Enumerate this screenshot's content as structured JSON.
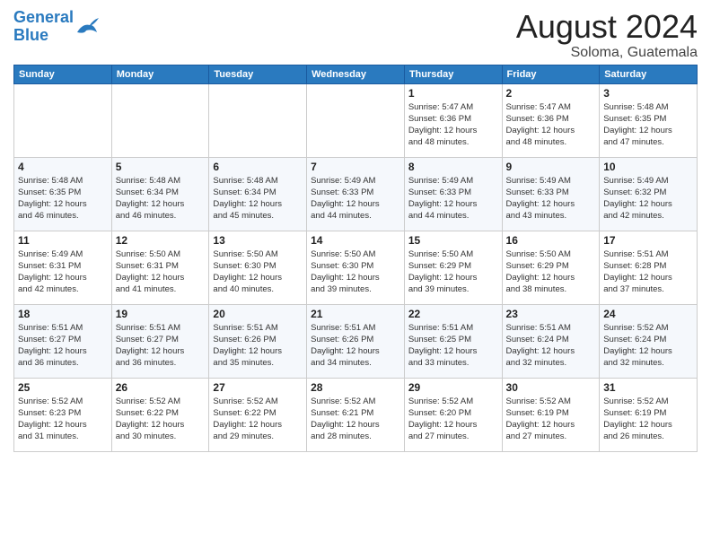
{
  "logo": {
    "line1": "General",
    "line2": "Blue"
  },
  "title": "August 2024",
  "subtitle": "Soloma, Guatemala",
  "days_of_week": [
    "Sunday",
    "Monday",
    "Tuesday",
    "Wednesday",
    "Thursday",
    "Friday",
    "Saturday"
  ],
  "weeks": [
    [
      {
        "day": "",
        "info": ""
      },
      {
        "day": "",
        "info": ""
      },
      {
        "day": "",
        "info": ""
      },
      {
        "day": "",
        "info": ""
      },
      {
        "day": "1",
        "info": "Sunrise: 5:47 AM\nSunset: 6:36 PM\nDaylight: 12 hours\nand 48 minutes."
      },
      {
        "day": "2",
        "info": "Sunrise: 5:47 AM\nSunset: 6:36 PM\nDaylight: 12 hours\nand 48 minutes."
      },
      {
        "day": "3",
        "info": "Sunrise: 5:48 AM\nSunset: 6:35 PM\nDaylight: 12 hours\nand 47 minutes."
      }
    ],
    [
      {
        "day": "4",
        "info": "Sunrise: 5:48 AM\nSunset: 6:35 PM\nDaylight: 12 hours\nand 46 minutes."
      },
      {
        "day": "5",
        "info": "Sunrise: 5:48 AM\nSunset: 6:34 PM\nDaylight: 12 hours\nand 46 minutes."
      },
      {
        "day": "6",
        "info": "Sunrise: 5:48 AM\nSunset: 6:34 PM\nDaylight: 12 hours\nand 45 minutes."
      },
      {
        "day": "7",
        "info": "Sunrise: 5:49 AM\nSunset: 6:33 PM\nDaylight: 12 hours\nand 44 minutes."
      },
      {
        "day": "8",
        "info": "Sunrise: 5:49 AM\nSunset: 6:33 PM\nDaylight: 12 hours\nand 44 minutes."
      },
      {
        "day": "9",
        "info": "Sunrise: 5:49 AM\nSunset: 6:33 PM\nDaylight: 12 hours\nand 43 minutes."
      },
      {
        "day": "10",
        "info": "Sunrise: 5:49 AM\nSunset: 6:32 PM\nDaylight: 12 hours\nand 42 minutes."
      }
    ],
    [
      {
        "day": "11",
        "info": "Sunrise: 5:49 AM\nSunset: 6:31 PM\nDaylight: 12 hours\nand 42 minutes."
      },
      {
        "day": "12",
        "info": "Sunrise: 5:50 AM\nSunset: 6:31 PM\nDaylight: 12 hours\nand 41 minutes."
      },
      {
        "day": "13",
        "info": "Sunrise: 5:50 AM\nSunset: 6:30 PM\nDaylight: 12 hours\nand 40 minutes."
      },
      {
        "day": "14",
        "info": "Sunrise: 5:50 AM\nSunset: 6:30 PM\nDaylight: 12 hours\nand 39 minutes."
      },
      {
        "day": "15",
        "info": "Sunrise: 5:50 AM\nSunset: 6:29 PM\nDaylight: 12 hours\nand 39 minutes."
      },
      {
        "day": "16",
        "info": "Sunrise: 5:50 AM\nSunset: 6:29 PM\nDaylight: 12 hours\nand 38 minutes."
      },
      {
        "day": "17",
        "info": "Sunrise: 5:51 AM\nSunset: 6:28 PM\nDaylight: 12 hours\nand 37 minutes."
      }
    ],
    [
      {
        "day": "18",
        "info": "Sunrise: 5:51 AM\nSunset: 6:27 PM\nDaylight: 12 hours\nand 36 minutes."
      },
      {
        "day": "19",
        "info": "Sunrise: 5:51 AM\nSunset: 6:27 PM\nDaylight: 12 hours\nand 36 minutes."
      },
      {
        "day": "20",
        "info": "Sunrise: 5:51 AM\nSunset: 6:26 PM\nDaylight: 12 hours\nand 35 minutes."
      },
      {
        "day": "21",
        "info": "Sunrise: 5:51 AM\nSunset: 6:26 PM\nDaylight: 12 hours\nand 34 minutes."
      },
      {
        "day": "22",
        "info": "Sunrise: 5:51 AM\nSunset: 6:25 PM\nDaylight: 12 hours\nand 33 minutes."
      },
      {
        "day": "23",
        "info": "Sunrise: 5:51 AM\nSunset: 6:24 PM\nDaylight: 12 hours\nand 32 minutes."
      },
      {
        "day": "24",
        "info": "Sunrise: 5:52 AM\nSunset: 6:24 PM\nDaylight: 12 hours\nand 32 minutes."
      }
    ],
    [
      {
        "day": "25",
        "info": "Sunrise: 5:52 AM\nSunset: 6:23 PM\nDaylight: 12 hours\nand 31 minutes."
      },
      {
        "day": "26",
        "info": "Sunrise: 5:52 AM\nSunset: 6:22 PM\nDaylight: 12 hours\nand 30 minutes."
      },
      {
        "day": "27",
        "info": "Sunrise: 5:52 AM\nSunset: 6:22 PM\nDaylight: 12 hours\nand 29 minutes."
      },
      {
        "day": "28",
        "info": "Sunrise: 5:52 AM\nSunset: 6:21 PM\nDaylight: 12 hours\nand 28 minutes."
      },
      {
        "day": "29",
        "info": "Sunrise: 5:52 AM\nSunset: 6:20 PM\nDaylight: 12 hours\nand 27 minutes."
      },
      {
        "day": "30",
        "info": "Sunrise: 5:52 AM\nSunset: 6:19 PM\nDaylight: 12 hours\nand 27 minutes."
      },
      {
        "day": "31",
        "info": "Sunrise: 5:52 AM\nSunset: 6:19 PM\nDaylight: 12 hours\nand 26 minutes."
      }
    ]
  ]
}
